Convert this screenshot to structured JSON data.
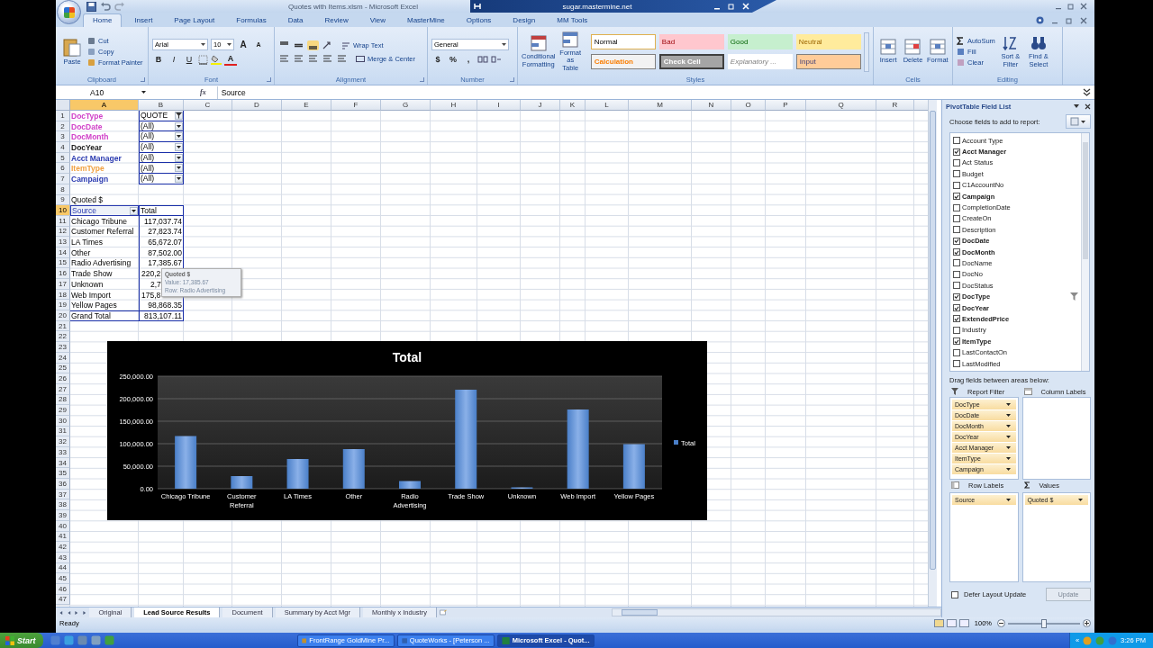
{
  "window": {
    "title": "Quotes with Items.xlsm - Microsoft Excel"
  },
  "remote_bar": {
    "host": "sugar.mastermine.net"
  },
  "tabs": [
    {
      "label": "Home",
      "selected": true
    },
    {
      "label": "Insert",
      "selected": false
    },
    {
      "label": "Page Layout",
      "selected": false
    },
    {
      "label": "Formulas",
      "selected": false
    },
    {
      "label": "Data",
      "selected": false
    },
    {
      "label": "Review",
      "selected": false
    },
    {
      "label": "View",
      "selected": false
    },
    {
      "label": "MasterMine",
      "selected": false
    },
    {
      "label": "Options",
      "selected": false
    },
    {
      "label": "Design",
      "selected": false
    },
    {
      "label": "MM Tools",
      "selected": false
    }
  ],
  "ribbon": {
    "clipboard": {
      "label": "Clipboard",
      "paste": "Paste",
      "commands": [
        "Cut",
        "Copy",
        "Format Painter"
      ]
    },
    "font": {
      "label": "Font",
      "family": "Arial",
      "size": "10",
      "grow": "A",
      "shrink": "A",
      "styles": [
        "B",
        "I",
        "U"
      ],
      "color_button": "A"
    },
    "alignment": {
      "label": "Alignment",
      "wrap": "Wrap Text",
      "merge": "Merge & Center"
    },
    "number": {
      "label": "Number",
      "format": "General",
      "symbols": [
        "$",
        "%",
        ","
      ]
    },
    "styles": {
      "label": "Styles",
      "commands": [
        "Conditional Formatting",
        "Format as Table"
      ],
      "cells": [
        {
          "label": "Normal",
          "kind": "normal"
        },
        {
          "label": "Bad",
          "kind": "bad"
        },
        {
          "label": "Good",
          "kind": "good"
        },
        {
          "label": "Neutral",
          "kind": "neutral"
        },
        {
          "label": "Calculation",
          "kind": "calculation"
        },
        {
          "label": "Check Cell",
          "kind": "check"
        },
        {
          "label": "Explanatory ...",
          "kind": "explanatory"
        },
        {
          "label": "Input",
          "kind": "input"
        }
      ]
    },
    "cells": {
      "label": "Cells",
      "commands": [
        "Insert",
        "Delete",
        "Format"
      ]
    },
    "editing": {
      "label": "Editing",
      "commands": [
        "AutoSum",
        "Fill",
        "Clear"
      ],
      "large": [
        "Sort & Filter",
        "Find & Select"
      ]
    }
  },
  "formula_bar": {
    "name_box": "A10",
    "function_label": "fx",
    "value": "Source"
  },
  "sheet": {
    "columns": [
      {
        "label": "A",
        "selected": true
      },
      {
        "label": "B",
        "selected": false
      },
      {
        "label": "C",
        "selected": false
      },
      {
        "label": "D",
        "selected": false
      },
      {
        "label": "E",
        "selected": false
      },
      {
        "label": "F",
        "selected": false
      },
      {
        "label": "G",
        "selected": false
      },
      {
        "label": "H",
        "selected": false
      },
      {
        "label": "I",
        "selected": false
      },
      {
        "label": "J",
        "selected": false
      },
      {
        "label": "K",
        "selected": false
      },
      {
        "label": "L",
        "selected": false
      },
      {
        "label": "M",
        "selected": false
      },
      {
        "label": "N",
        "selected": false
      },
      {
        "label": "O",
        "selected": false
      },
      {
        "label": "P",
        "selected": false
      },
      {
        "label": "Q",
        "selected": false
      },
      {
        "label": "R",
        "selected": false
      }
    ],
    "rows": [
      {
        "number": "1",
        "selected": false,
        "cells": [
          {
            "kind": "label",
            "text": "DocType",
            "color": "#d040c8"
          },
          {
            "kind": "filter_value",
            "text": "QUOTE",
            "filtered": true
          }
        ]
      },
      {
        "number": "2",
        "selected": false,
        "cells": [
          {
            "kind": "label",
            "text": "DocDate",
            "color": "#d040c8"
          },
          {
            "kind": "filter_value",
            "text": "(All)",
            "filtered": false
          }
        ]
      },
      {
        "number": "3",
        "selected": false,
        "cells": [
          {
            "kind": "label",
            "text": "DocMonth",
            "color": "#d040c8"
          },
          {
            "kind": "filter_value",
            "text": "(All)",
            "filtered": false
          }
        ]
      },
      {
        "number": "4",
        "selected": false,
        "cells": [
          {
            "kind": "label",
            "text": "DocYear",
            "color": "#202020"
          },
          {
            "kind": "filter_value",
            "text": "(All)",
            "filtered": false
          }
        ]
      },
      {
        "number": "5",
        "selected": false,
        "cells": [
          {
            "kind": "label",
            "text": "Acct Manager",
            "color": "#2a3ab0"
          },
          {
            "kind": "filter_value",
            "text": "(All)",
            "filtered": false
          }
        ]
      },
      {
        "number": "6",
        "selected": false,
        "cells": [
          {
            "kind": "label",
            "text": "ItemType",
            "color": "#f0a040"
          },
          {
            "kind": "filter_value",
            "text": "(All)",
            "filtered": false
          }
        ]
      },
      {
        "number": "7",
        "selected": false,
        "cells": [
          {
            "kind": "label",
            "text": "Campaign",
            "color": "#2a3ab0"
          },
          {
            "kind": "filter_value",
            "text": "(All)",
            "filtered": false
          }
        ]
      },
      {
        "number": "8",
        "selected": false
      },
      {
        "number": "9",
        "selected": false,
        "cells": [
          {
            "kind": "caption",
            "text": "Quoted $"
          }
        ]
      },
      {
        "number": "10",
        "selected": true,
        "cells": [
          {
            "kind": "field_header",
            "text": "Source"
          },
          {
            "kind": "total_header",
            "text": "Total"
          }
        ]
      },
      {
        "number": "11",
        "selected": false,
        "cells": [
          {
            "kind": "caption",
            "text": "Chicago Tribune"
          },
          {
            "kind": "number",
            "text": "117,037.74"
          }
        ]
      },
      {
        "number": "12",
        "selected": false,
        "cells": [
          {
            "kind": "caption",
            "text": "Customer Referral"
          },
          {
            "kind": "number",
            "text": "27,823.74"
          }
        ]
      },
      {
        "number": "13",
        "selected": false,
        "cells": [
          {
            "kind": "caption",
            "text": "LA Times"
          },
          {
            "kind": "number",
            "text": "65,672.07"
          }
        ]
      },
      {
        "number": "14",
        "selected": false,
        "cells": [
          {
            "kind": "caption",
            "text": "Other"
          },
          {
            "kind": "number",
            "text": "87,502.00"
          }
        ]
      },
      {
        "number": "15",
        "selected": false,
        "cells": [
          {
            "kind": "caption",
            "text": "Radio Advertising"
          },
          {
            "kind": "number",
            "text": "17,385.67"
          }
        ]
      },
      {
        "number": "16",
        "selected": false,
        "cells": [
          {
            "kind": "caption",
            "text": "Trade Show"
          },
          {
            "kind": "covered",
            "text": "220,2"
          }
        ]
      },
      {
        "number": "17",
        "selected": false,
        "cells": [
          {
            "kind": "caption",
            "text": "Unknown"
          },
          {
            "kind": "covered_short",
            "text": "2,7"
          }
        ]
      },
      {
        "number": "18",
        "selected": false,
        "cells": [
          {
            "kind": "caption",
            "text": "Web Import"
          },
          {
            "kind": "covered",
            "text": "175,8"
          }
        ]
      },
      {
        "number": "19",
        "selected": false,
        "cells": [
          {
            "kind": "caption",
            "text": "Yellow Pages"
          },
          {
            "kind": "number",
            "text": "98,868.35"
          }
        ]
      },
      {
        "number": "20",
        "selected": false,
        "cells": [
          {
            "kind": "grand_label",
            "text": "Grand Total"
          },
          {
            "kind": "grand_total",
            "text": "813,107.11"
          }
        ]
      },
      {
        "number": "21",
        "selected": false
      },
      {
        "number": "22",
        "selected": false
      },
      {
        "number": "23",
        "selected": false
      },
      {
        "number": "24",
        "selected": false
      },
      {
        "number": "25",
        "selected": false
      },
      {
        "number": "26",
        "selected": false
      },
      {
        "number": "27",
        "selected": false
      },
      {
        "number": "28",
        "selected": false
      },
      {
        "number": "29",
        "selected": false
      },
      {
        "number": "30",
        "selected": false
      },
      {
        "number": "31",
        "selected": false
      },
      {
        "number": "32",
        "selected": false
      },
      {
        "number": "33",
        "selected": false
      },
      {
        "number": "34",
        "selected": false
      },
      {
        "number": "35",
        "selected": false
      },
      {
        "number": "36",
        "selected": false
      },
      {
        "number": "37",
        "selected": false
      },
      {
        "number": "38",
        "selected": false
      },
      {
        "number": "39",
        "selected": false
      },
      {
        "number": "40",
        "selected": false
      },
      {
        "number": "41",
        "selected": false
      },
      {
        "number": "42",
        "selected": false
      },
      {
        "number": "43",
        "selected": false
      },
      {
        "number": "44",
        "selected": false
      },
      {
        "number": "45",
        "selected": false
      },
      {
        "number": "46",
        "selected": false
      },
      {
        "number": "47",
        "selected": false
      }
    ]
  },
  "tooltip": {
    "title": "Quoted $",
    "lines": [
      "Value: 17,385.67",
      "Row: Radio Advertising"
    ]
  },
  "chart": {
    "chart_data": {
      "type": "bar",
      "title": "Total",
      "categories": [
        "Chicago Tribune",
        "Customer Referral",
        "LA Times",
        "Other",
        "Radio Advertising",
        "Trade Show",
        "Unknown",
        "Web Import",
        "Yellow Pages"
      ],
      "series": [
        {
          "name": "Total",
          "color": "#4a7fc8",
          "values": [
            117000,
            28000,
            66000,
            88000,
            17000,
            220000,
            3000,
            176000,
            99000
          ]
        }
      ],
      "grid": true,
      "ylim": [
        0,
        250000
      ],
      "yticks": [
        {
          "value": 0,
          "label": "0.00"
        },
        {
          "value": 50000,
          "label": "50,000.00"
        },
        {
          "value": 100000,
          "label": "100,000.00"
        },
        {
          "value": 150000,
          "label": "150,000.00"
        },
        {
          "value": 200000,
          "label": "200,000.00"
        },
        {
          "value": 250000,
          "label": "250,000.00"
        }
      ]
    }
  },
  "pivot_pane": {
    "title": "PivotTable Field List",
    "prompt": "Choose fields to add to report:",
    "fields": [
      {
        "label": "Account Type",
        "checked": false,
        "filtered": false
      },
      {
        "label": "Acct Manager",
        "checked": true,
        "filtered": false
      },
      {
        "label": "Act Status",
        "checked": false,
        "filtered": false
      },
      {
        "label": "Budget",
        "checked": false,
        "filtered": false
      },
      {
        "label": "C1AccountNo",
        "checked": false,
        "filtered": false
      },
      {
        "label": "Campaign",
        "checked": true,
        "filtered": false
      },
      {
        "label": "CompletionDate",
        "checked": false,
        "filtered": false
      },
      {
        "label": "CreateOn",
        "checked": false,
        "filtered": false
      },
      {
        "label": "Description",
        "checked": false,
        "filtered": false
      },
      {
        "label": "DocDate",
        "checked": true,
        "filtered": false
      },
      {
        "label": "DocMonth",
        "checked": true,
        "filtered": false
      },
      {
        "label": "DocName",
        "checked": false,
        "filtered": false
      },
      {
        "label": "DocNo",
        "checked": false,
        "filtered": false
      },
      {
        "label": "DocStatus",
        "checked": false,
        "filtered": false
      },
      {
        "label": "DocType",
        "checked": true,
        "filtered": true
      },
      {
        "label": "DocYear",
        "checked": true,
        "filtered": false
      },
      {
        "label": "ExtendedPrice",
        "checked": true,
        "filtered": false
      },
      {
        "label": "Industry",
        "checked": false,
        "filtered": false
      },
      {
        "label": "ItemType",
        "checked": true,
        "filtered": false
      },
      {
        "label": "LastContactOn",
        "checked": false,
        "filtered": false
      },
      {
        "label": "LastModified",
        "checked": false,
        "filtered": false
      }
    ],
    "areas_prompt": "Drag fields between areas below:",
    "report_filter": {
      "label": "Report Filter",
      "items": [
        "DocType",
        "DocDate",
        "DocMonth",
        "DocYear",
        "Acct Manager",
        "ItemType",
        "Campaign"
      ]
    },
    "column_labels": {
      "label": "Column Labels"
    },
    "row_labels": {
      "label": "Row Labels",
      "items": [
        "Source"
      ]
    },
    "values": {
      "label": "Values",
      "items": [
        "Quoted $"
      ]
    },
    "defer": {
      "label": "Defer Layout Update",
      "checked": false
    },
    "update": {
      "label": "Update",
      "disabled": true
    }
  },
  "sheet_tabs": [
    {
      "label": "Original",
      "selected": false
    },
    {
      "label": "Lead Source Results",
      "selected": true
    },
    {
      "label": "Document",
      "selected": false
    },
    {
      "label": "Summary by Acct Mgr",
      "selected": false
    },
    {
      "label": "Monthly x Industry",
      "selected": false
    }
  ],
  "status_bar": {
    "text": "Ready",
    "zoom": {
      "label": "100%",
      "level": 0.5
    }
  },
  "taskbar": {
    "start": "Start",
    "tasks": [
      {
        "label": "FrontRange GoldMine Pr...",
        "selected": false
      },
      {
        "label": "QuoteWorks - [Peterson ...",
        "selected": false
      },
      {
        "label": "Microsoft Excel - Quot...",
        "selected": true
      }
    ],
    "tray_toggle": "«",
    "clock": "3:26 PM"
  }
}
